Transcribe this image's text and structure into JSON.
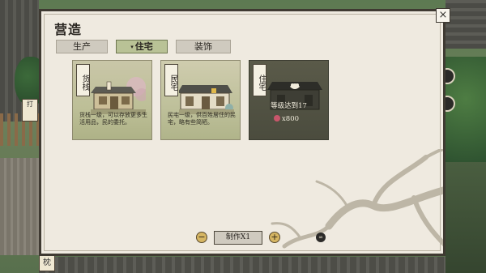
{
  "panel": {
    "title": "营造",
    "close_icon": "×"
  },
  "tabs": [
    {
      "label": "生产",
      "active": false
    },
    {
      "label": "住宅",
      "active": true,
      "arrow": "▾"
    },
    {
      "label": "装饰",
      "active": false
    }
  ],
  "cards": [
    {
      "label": "货栈",
      "desc": "货栈一级，可以存放更多生活用品，民的委托。",
      "locked": false
    },
    {
      "label": "民宅",
      "desc": "民宅一级，供百姓居住的民宅，略有些简陋。",
      "locked": false
    },
    {
      "label": "住宅",
      "locked": true,
      "requirement": "等级达到17",
      "cost": "x800"
    }
  ],
  "footer": {
    "minus_icon": "−",
    "plus_icon": "+",
    "make_label": "制作X1",
    "info_icon": "∞"
  },
  "world": {
    "tree_sign": "打",
    "bottom_sign": "枕"
  },
  "colors": {
    "panel_bg": "#efeae0",
    "active_tab": "#b9c296",
    "coin": "#c9566b"
  }
}
